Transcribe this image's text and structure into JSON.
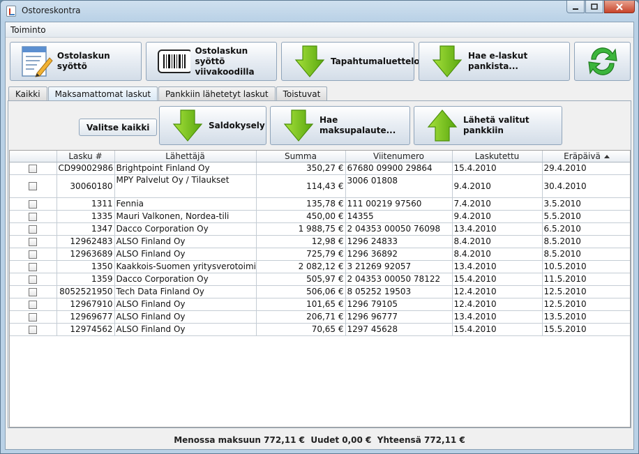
{
  "window": {
    "title": "Ostoreskontra"
  },
  "menubar": {
    "items": [
      "Toiminto"
    ]
  },
  "toolbar": {
    "buttons": [
      {
        "label": "Ostolaskun syöttö",
        "icon": "invoice-edit-icon"
      },
      {
        "label_line1": "Ostolaskun syöttö",
        "label_line2": "viivakoodilla",
        "icon": "barcode-icon"
      },
      {
        "label": "Tapahtumaluettelo",
        "icon": "arrow-down-icon"
      },
      {
        "label": "Hae e-laskut pankista...",
        "icon": "arrow-down-icon"
      },
      {
        "label": "",
        "icon": "refresh-icon"
      }
    ]
  },
  "tabs": [
    {
      "label": "Kaikki",
      "active": false
    },
    {
      "label": "Maksamattomat laskut",
      "active": true
    },
    {
      "label": "Pankkiin lähetetyt laskut",
      "active": false
    },
    {
      "label": "Toistuvat",
      "active": false
    }
  ],
  "panel": {
    "select_all_label": "Valitse kaikki",
    "buttons": [
      {
        "label": "Saldokysely",
        "icon": "arrow-down-icon"
      },
      {
        "label": "Hae maksupalaute...",
        "icon": "arrow-down-icon"
      },
      {
        "label": "Lähetä valitut pankkiin",
        "icon": "arrow-up-icon"
      }
    ]
  },
  "table": {
    "columns": [
      "",
      "Lasku #",
      "Lähettäjä",
      "Summa",
      "Viitenumero",
      "Laskutettu",
      "Eräpäivä"
    ],
    "sort_column": "Eräpäivä",
    "rows": [
      {
        "lasku": "CD99002986",
        "lahettaja": "Brightpoint Finland Oy",
        "summa": "350,27 €",
        "viite": "67680 09900 29864",
        "laskutettu": "15.4.2010",
        "erapaiva": "29.4.2010"
      },
      {
        "lasku": "30060180",
        "lahettaja": "MPY Palvelut Oy / Tilaukset",
        "summa": "114,43 €",
        "viite": "3006 01808",
        "laskutettu": "9.4.2010",
        "erapaiva": "30.4.2010"
      },
      {
        "lasku": "1311",
        "lahettaja": "Fennia",
        "summa": "135,78 €",
        "viite": "111 00219 97560",
        "laskutettu": "7.4.2010",
        "erapaiva": "3.5.2010"
      },
      {
        "lasku": "1335",
        "lahettaja": "Mauri Valkonen, Nordea-tili",
        "summa": "450,00 €",
        "viite": "14355",
        "laskutettu": "9.4.2010",
        "erapaiva": "5.5.2010"
      },
      {
        "lasku": "1347",
        "lahettaja": "Dacco Corporation Oy",
        "summa": "1 988,75 €",
        "viite": "2 04353 00050 76098",
        "laskutettu": "13.4.2010",
        "erapaiva": "6.5.2010"
      },
      {
        "lasku": "12962483",
        "lahettaja": "ALSO Finland Oy",
        "summa": "12,98 €",
        "viite": "1296 24833",
        "laskutettu": "8.4.2010",
        "erapaiva": "8.5.2010"
      },
      {
        "lasku": "12963689",
        "lahettaja": "ALSO Finland Oy",
        "summa": "725,79 €",
        "viite": "1296 36892",
        "laskutettu": "8.4.2010",
        "erapaiva": "8.5.2010"
      },
      {
        "lasku": "1350",
        "lahettaja": "Kaakkois-Suomen yritysverotoimisto",
        "summa": "2 082,12 €",
        "viite": "3 21269 92057",
        "laskutettu": "13.4.2010",
        "erapaiva": "10.5.2010"
      },
      {
        "lasku": "1359",
        "lahettaja": "Dacco Corporation Oy",
        "summa": "505,97 €",
        "viite": "2 04353 00050 78122",
        "laskutettu": "15.4.2010",
        "erapaiva": "11.5.2010"
      },
      {
        "lasku": "8052521950",
        "lahettaja": "Tech Data Finland Oy",
        "summa": "506,06 €",
        "viite": "8 05252 19503",
        "laskutettu": "12.4.2010",
        "erapaiva": "12.5.2010"
      },
      {
        "lasku": "12967910",
        "lahettaja": "ALSO Finland Oy",
        "summa": "101,65 €",
        "viite": "1296 79105",
        "laskutettu": "12.4.2010",
        "erapaiva": "12.5.2010"
      },
      {
        "lasku": "12969677",
        "lahettaja": "ALSO Finland Oy",
        "summa": "206,71 €",
        "viite": "1296 96777",
        "laskutettu": "13.4.2010",
        "erapaiva": "13.5.2010"
      },
      {
        "lasku": "12974562",
        "lahettaja": "ALSO Finland Oy",
        "summa": "70,65 €",
        "viite": "1297 45628",
        "laskutettu": "15.4.2010",
        "erapaiva": "15.5.2010"
      }
    ]
  },
  "status": {
    "text": "Menossa maksuun 772,11 €  Uudet 0,00 €  Yhteensä 772,11 €"
  },
  "colors": {
    "arrow_green": "#7bc91a",
    "arrow_green_dark": "#4c8f0b",
    "refresh_green": "#2fa82f"
  }
}
